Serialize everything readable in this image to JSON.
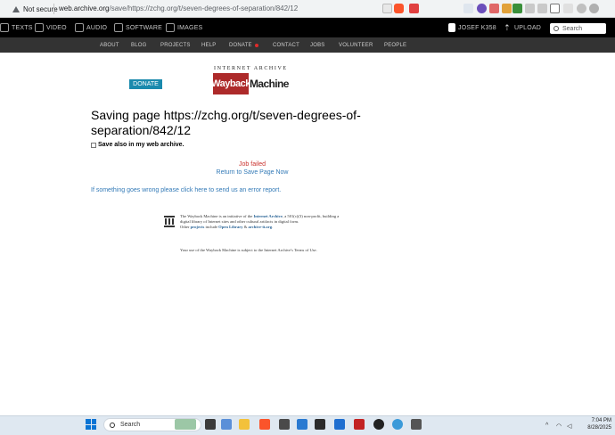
{
  "browser": {
    "security_label": "Not secure",
    "url_host": "web.archive.org",
    "url_path": "/save/https://zchg.org/t/seven-degrees-of-separation/842/12"
  },
  "ia_nav": {
    "items": [
      {
        "label": "TEXTS",
        "icon": "book-icon"
      },
      {
        "label": "VIDEO",
        "icon": "film-icon"
      },
      {
        "label": "AUDIO",
        "icon": "speaker-icon"
      },
      {
        "label": "SOFTWARE",
        "icon": "floppy-icon"
      },
      {
        "label": "IMAGES",
        "icon": "image-icon"
      }
    ],
    "user": "JOSEF K358",
    "upload": "UPLOAD",
    "search_placeholder": "Search"
  },
  "sub_nav": [
    "ABOUT",
    "BLOG",
    "PROJECTS",
    "HELP",
    "DONATE",
    "CONTACT",
    "JOBS",
    "VOLUNTEER",
    "PEOPLE"
  ],
  "donate_button": "DONATE",
  "logo": {
    "top_text": "INTERNET ARCHIVE",
    "wayback": "Wayback",
    "machine": "Machine"
  },
  "main": {
    "title": "Saving page https://zchg.org/t/seven-degrees-of-separation/842/12",
    "save_also": "Save also in my web archive.",
    "job_failed": "Job failed",
    "return_link": "Return to Save Page Now",
    "error_link": "If something goes wrong please click here to send us an error report."
  },
  "footer": {
    "line1_pre": "The Wayback Machine is an initiative of the ",
    "line1_link": "Internet Archive",
    "line1_post": ", a 501(c)(3) non-profit, building a digital library of Internet sites and other cultural artifacts in digital form.",
    "line2_pre": "Other ",
    "line2_link1": "projects",
    "line2_mid": " include ",
    "line2_link2": "Open Library",
    "line2_amp": " & ",
    "line2_link3": "archive-it.org",
    "line2_end": ".",
    "line3_pre": "Your use of the Wayback Machine is subject to the Internet Archive's ",
    "line3_link": "Terms of Use",
    "line3_end": "."
  },
  "taskbar": {
    "search_placeholder": "Search",
    "time": "7:04 PM",
    "date": "8/28/2025"
  },
  "colors": {
    "accent_blue": "#1a8aad",
    "wayback_red": "#ad2a2a",
    "error_red": "#c9302c",
    "link_blue": "#337ab7"
  }
}
